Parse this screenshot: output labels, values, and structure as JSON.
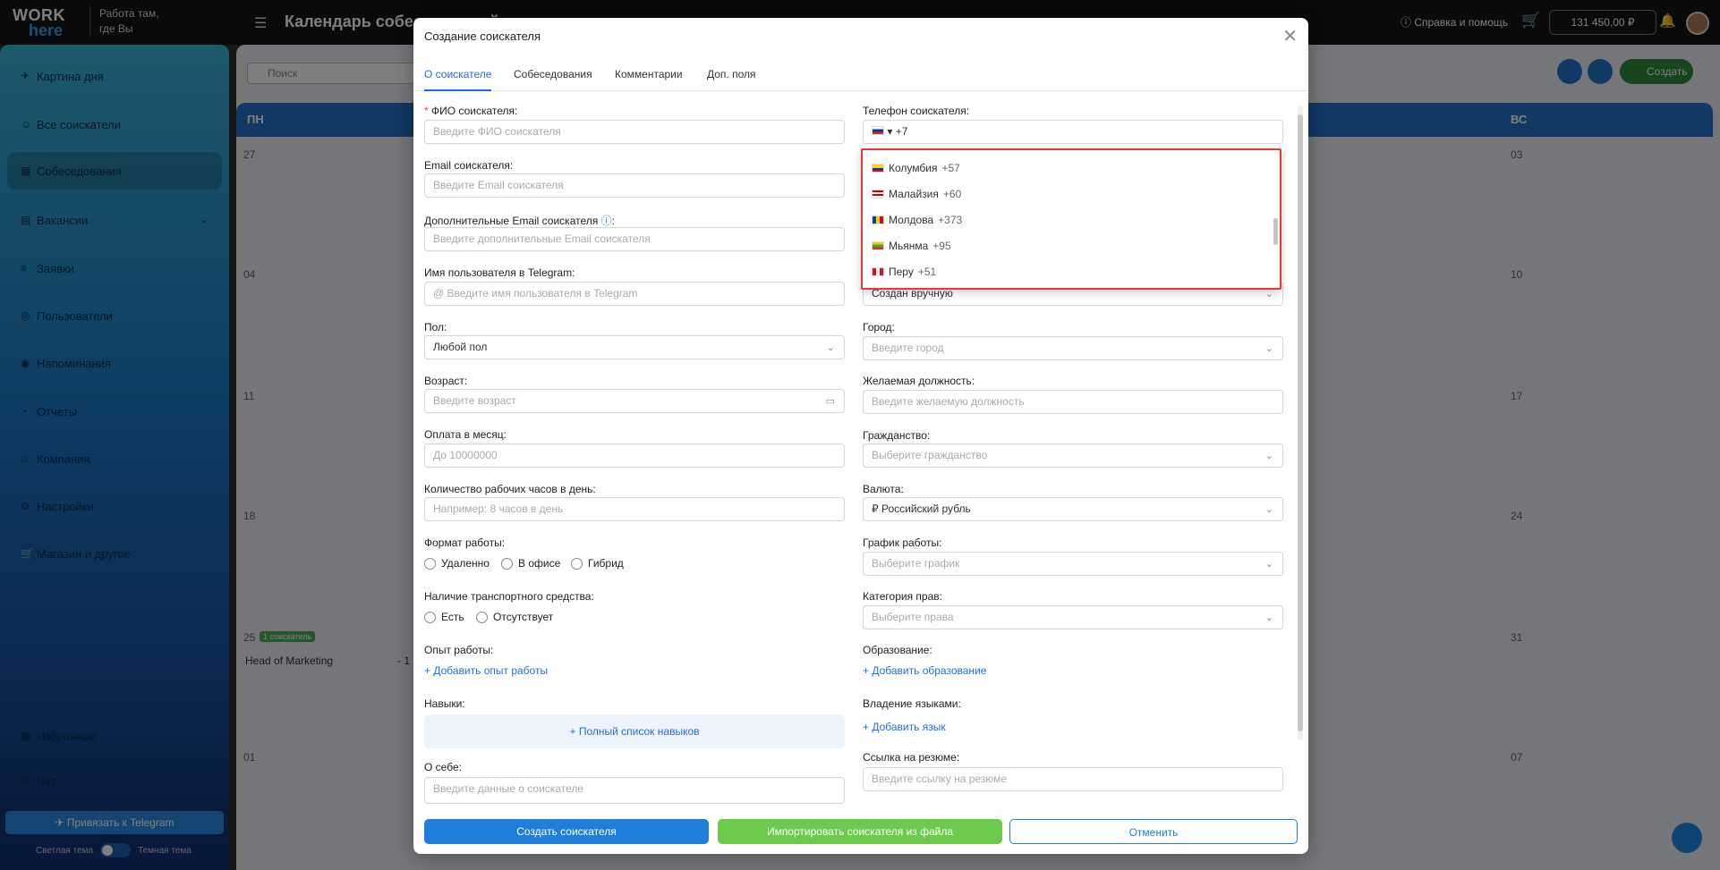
{
  "topbar": {
    "logo_line1": "WORK",
    "logo_line2": "here",
    "tagline": "Работа там, где Вы",
    "title": "Календарь собеседований",
    "help": "Справка и помощь",
    "balance": "131 450,00 ₽"
  },
  "sidebar": {
    "items": [
      {
        "label": "Картина дня",
        "icon": "rocket-icon"
      },
      {
        "label": "Все соискатели",
        "icon": "users-icon"
      },
      {
        "label": "Собеседования",
        "icon": "calendar-icon"
      },
      {
        "label": "Вакансии",
        "icon": "vacancies-icon"
      },
      {
        "label": "Заявки",
        "icon": "list-icon"
      },
      {
        "label": "Пользователи",
        "icon": "user-icon"
      },
      {
        "label": "Напоминания",
        "icon": "reminder-icon"
      },
      {
        "label": "Отчеты",
        "icon": "reports-icon"
      },
      {
        "label": "Компания",
        "icon": "home-icon"
      },
      {
        "label": "Настройки",
        "icon": "settings-icon"
      },
      {
        "label": "Магазин и другое",
        "icon": "shop-icon"
      },
      {
        "label": "Избранное",
        "icon": "grid-icon"
      },
      {
        "label": "Чат",
        "icon": "chat-icon"
      }
    ],
    "telegram_button": "Привязать к Telegram",
    "theme_light": "Светлая тема",
    "theme_dark": "Темная тема"
  },
  "calendar": {
    "search_placeholder": "Поиск",
    "create_button": "Создать",
    "days": [
      "ПН",
      "ВС"
    ],
    "dates": [
      "27",
      "03",
      "04",
      "10",
      "11",
      "17",
      "18",
      "24",
      "25",
      "31",
      "01",
      "07"
    ],
    "badge": "1 соискатель",
    "event": "Head of Marketing",
    "event_tail": "- 1"
  },
  "modal": {
    "title": "Создание соискателя",
    "tabs": [
      "О соискателе",
      "Собеседования",
      "Комментарии",
      "Доп. поля"
    ],
    "left": {
      "fio_label": "ФИО соискателя",
      "fio_placeholder": "Введите ФИО соискателя",
      "email_label": "Email соискателя",
      "email_placeholder": "Введите Email соискателя",
      "add_email_label": "Дополнительные Email соискателя",
      "add_email_placeholder": "Введите дополнительные Email соискателя",
      "tg_label": "Имя пользователя в Telegram",
      "tg_placeholder": "@ Введите имя пользователя в Telegram",
      "gender_label": "Пол",
      "gender_value": "Любой пол",
      "age_label": "Возраст",
      "age_placeholder": "Введите возраст",
      "pay_label": "Оплата в месяц",
      "pay_placeholder": "До 10000000",
      "hours_label": "Количество рабочих часов в день",
      "hours_placeholder": "Например: 8 часов в день",
      "format_label": "Формат работы",
      "format_options": [
        "Удаленно",
        "В офисе",
        "Гибрид"
      ],
      "transport_label": "Наличие транспортного средства",
      "transport_options": [
        "Есть",
        "Отсутствует"
      ],
      "experience_label": "Опыт работы",
      "experience_link": "Добавить опыт работы",
      "skills_label": "Навыки",
      "skills_link": "Полный список навыков",
      "about_label": "О себе",
      "about_placeholder": "Введите данные о соискателе"
    },
    "right": {
      "phone_label": "Телефон соискателя",
      "phone_value": "+7",
      "source_value": "Создан вручную",
      "city_label": "Город",
      "city_placeholder": "Введите город",
      "position_label": "Желаемая должность",
      "position_placeholder": "Введите желаемую должность",
      "citizenship_label": "Гражданство",
      "citizenship_placeholder": "Выберите гражданство",
      "currency_label": "Валюта",
      "currency_value": "₽ Российский рубль",
      "schedule_label": "График работы",
      "schedule_placeholder": "Выберите график",
      "license_label": "Категория прав",
      "license_placeholder": "Выберите права",
      "education_label": "Образование",
      "education_link": "Добавить образование",
      "languages_label": "Владение языками",
      "languages_link": "Добавить язык",
      "resume_label": "Ссылка на резюме",
      "resume_placeholder": "Введите ссылку на резюме"
    },
    "country_dropdown": [
      {
        "name": "Колумбия",
        "code": "+57",
        "colors": [
          "#fcd116",
          "#003893",
          "#ce1126"
        ]
      },
      {
        "name": "Малайзия",
        "code": "+60",
        "colors": [
          "#cc0001",
          "#ffffff",
          "#010066"
        ]
      },
      {
        "name": "Молдова",
        "code": "+373",
        "colors": [
          "#0046ae",
          "#ffd200",
          "#cc092f"
        ]
      },
      {
        "name": "Мьянма",
        "code": "+95",
        "colors": [
          "#fecb00",
          "#34b233",
          "#ea2839"
        ]
      },
      {
        "name": "Перу",
        "code": "+51",
        "colors": [
          "#d91023",
          "#ffffff",
          "#d91023"
        ]
      }
    ],
    "buttons": {
      "create": "Создать соискателя",
      "import": "Импортировать соискателя из файла",
      "cancel": "Отменить"
    }
  }
}
